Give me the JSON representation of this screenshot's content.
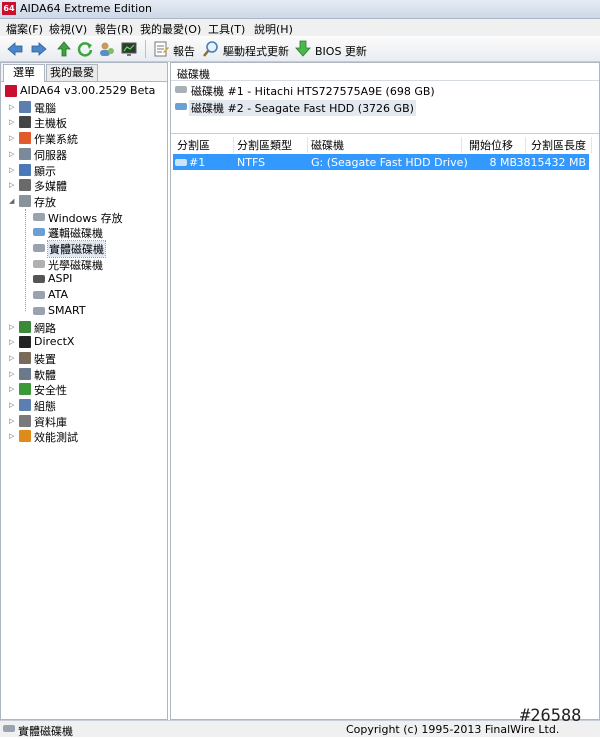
{
  "window": {
    "title": "AIDA64 Extreme Edition",
    "logo_text": "64"
  },
  "menu": [
    {
      "label": "檔案(F)"
    },
    {
      "label": "檢視(V)"
    },
    {
      "label": "報告(R)"
    },
    {
      "label": "我的最愛(O)"
    },
    {
      "label": "工具(T)"
    },
    {
      "label": "說明(H)"
    }
  ],
  "toolbar": {
    "report_label": "報告",
    "driver_update_label": "驅動程式更新",
    "bios_update_label": "BIOS 更新"
  },
  "left_panel": {
    "tabs": [
      {
        "label": "選單"
      },
      {
        "label": "我的最愛"
      }
    ],
    "tree": [
      {
        "label": "AIDA64 v3.00.2529 Beta",
        "level": 0,
        "icon": "aida-logo-icon",
        "expander": ""
      },
      {
        "label": "電腦",
        "level": 1,
        "icon": "computer-icon",
        "expander": "▷"
      },
      {
        "label": "主機板",
        "level": 1,
        "icon": "motherboard-icon",
        "expander": "▷"
      },
      {
        "label": "作業系統",
        "level": 1,
        "icon": "windows-icon",
        "expander": "▷"
      },
      {
        "label": "伺服器",
        "level": 1,
        "icon": "server-icon",
        "expander": "▷"
      },
      {
        "label": "顯示",
        "level": 1,
        "icon": "monitor-icon",
        "expander": "▷"
      },
      {
        "label": "多媒體",
        "level": 1,
        "icon": "speaker-icon",
        "expander": "▷"
      },
      {
        "label": "存放",
        "level": 1,
        "icon": "storage-icon",
        "expander": "◢"
      },
      {
        "label": "Windows 存放",
        "level": 2,
        "icon": "disk-icon",
        "expander": ""
      },
      {
        "label": "邏輯磁碟機",
        "level": 2,
        "icon": "logical-drive-icon",
        "expander": ""
      },
      {
        "label": "實體磁碟機",
        "level": 2,
        "icon": "physical-drive-icon",
        "expander": ""
      },
      {
        "label": "光學磁碟機",
        "level": 2,
        "icon": "optical-drive-icon",
        "expander": ""
      },
      {
        "label": "ASPI",
        "level": 2,
        "icon": "aspi-icon",
        "expander": ""
      },
      {
        "label": "ATA",
        "level": 2,
        "icon": "ata-icon",
        "expander": ""
      },
      {
        "label": "SMART",
        "level": 2,
        "icon": "smart-icon",
        "expander": ""
      },
      {
        "label": "網路",
        "level": 1,
        "icon": "network-icon",
        "expander": "▷"
      },
      {
        "label": "DirectX",
        "level": 1,
        "icon": "directx-icon",
        "expander": "▷"
      },
      {
        "label": "裝置",
        "level": 1,
        "icon": "devices-icon",
        "expander": "▷"
      },
      {
        "label": "軟體",
        "level": 1,
        "icon": "software-icon",
        "expander": "▷"
      },
      {
        "label": "安全性",
        "level": 1,
        "icon": "security-shield-icon",
        "expander": "▷"
      },
      {
        "label": "組態",
        "level": 1,
        "icon": "config-icon",
        "expander": "▷"
      },
      {
        "label": "資料庫",
        "level": 1,
        "icon": "database-icon",
        "expander": "▷"
      },
      {
        "label": "效能測試",
        "level": 1,
        "icon": "benchmark-icon",
        "expander": "▷"
      }
    ]
  },
  "right_panel": {
    "section_title": "磁碟機",
    "disks": [
      {
        "label": "磁碟機 #1 - Hitachi HTS727575A9E (698 GB)"
      },
      {
        "label": "磁碟機 #2 - Seagate Fast HDD (3726 GB)"
      }
    ],
    "columns": [
      "分割區",
      "分割區類型",
      "磁碟機",
      "開始位移",
      "分割區長度"
    ],
    "rows": [
      {
        "partition": "#1",
        "type": "NTFS",
        "drive": "G: (Seagate Fast HDD Drive)",
        "offset": "8 MB",
        "length": "3815432 MB"
      }
    ]
  },
  "status": {
    "left": "實體磁碟機",
    "right": "Copyright (c) 1995-2013 FinalWire Ltd."
  },
  "watermark": "#26588"
}
